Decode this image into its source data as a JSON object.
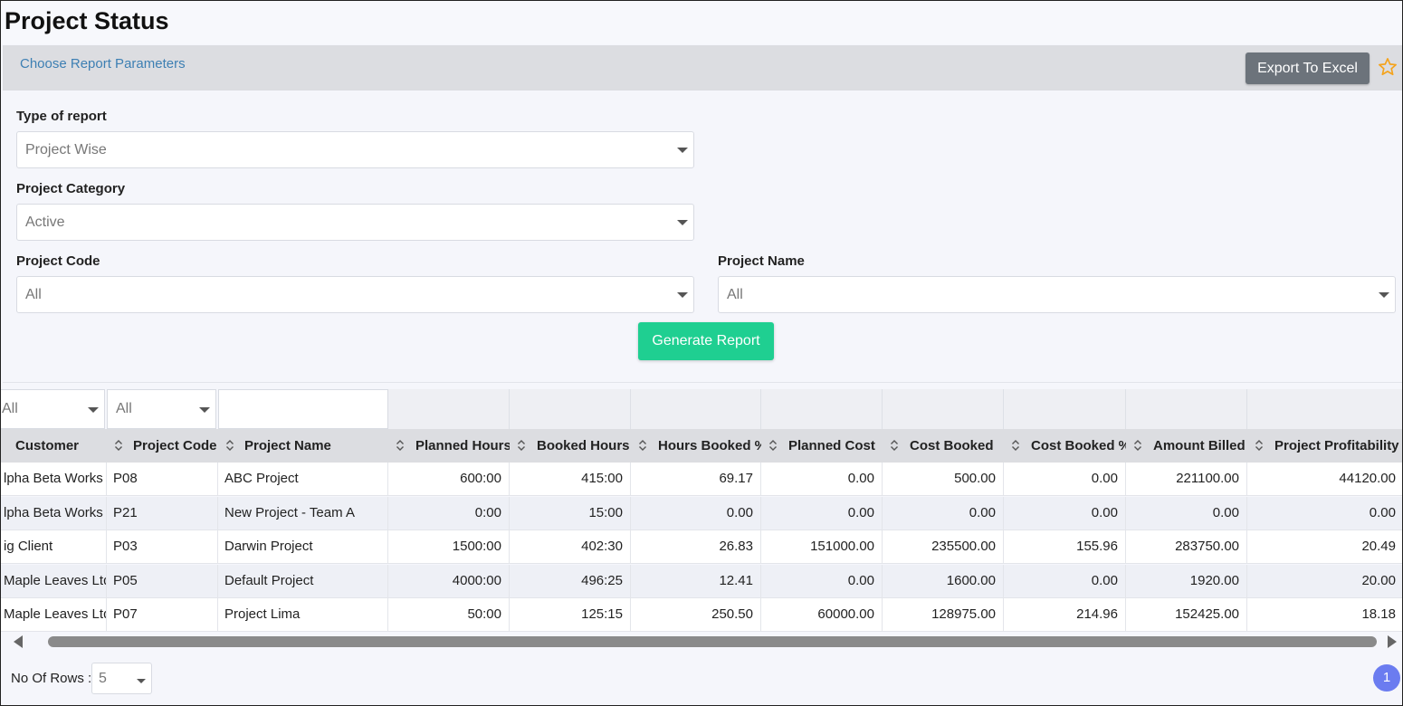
{
  "page": {
    "title": "Project Status"
  },
  "params_bar": {
    "link_label": "Choose Report Parameters",
    "export_label": "Export To Excel",
    "star_icon": "star-outline-icon",
    "star_color": "#f4a31c"
  },
  "form": {
    "type_of_report": {
      "label": "Type of report",
      "value": "Project Wise"
    },
    "project_category": {
      "label": "Project Category",
      "value": "Active"
    },
    "project_code": {
      "label": "Project Code",
      "value": "All"
    },
    "project_name": {
      "label": "Project Name",
      "value": "All"
    },
    "generate_label": "Generate Report",
    "generate_color": "#1fcf91"
  },
  "grid": {
    "filters": {
      "customer": "All",
      "project_code": "All",
      "project_name": ""
    },
    "columns": [
      "Customer",
      "Project Code",
      "Project Name",
      "Planned Hours",
      "Booked Hours",
      "Hours Booked %",
      "Planned Cost",
      "Cost Booked",
      "Cost Booked %",
      "Amount Billed",
      "Project Profitability %"
    ],
    "rows": [
      [
        "lpha Beta Works",
        "P08",
        "ABC Project",
        "600:00",
        "415:00",
        "69.17",
        "0.00",
        "500.00",
        "0.00",
        "221100.00",
        "44120.00"
      ],
      [
        "lpha Beta Works",
        "P21",
        "New Project - Team A",
        "0:00",
        "15:00",
        "0.00",
        "0.00",
        "0.00",
        "0.00",
        "0.00",
        "0.00"
      ],
      [
        "ig Client",
        "P03",
        "Darwin Project",
        "1500:00",
        "402:30",
        "26.83",
        "151000.00",
        "235500.00",
        "155.96",
        "283750.00",
        "20.49"
      ],
      [
        "Maple Leaves Ltd",
        "P05",
        "Default Project",
        "4000:00",
        "496:25",
        "12.41",
        "0.00",
        "1600.00",
        "0.00",
        "1920.00",
        "20.00"
      ],
      [
        "Maple Leaves Ltd",
        "P07",
        "Project Lima",
        "50:00",
        "125:15",
        "250.50",
        "60000.00",
        "128975.00",
        "214.96",
        "152425.00",
        "18.18"
      ]
    ]
  },
  "pager": {
    "rows_label": "No Of Rows :",
    "rows_value": "5",
    "current_page": "1",
    "page_color": "#6b7cf0"
  }
}
